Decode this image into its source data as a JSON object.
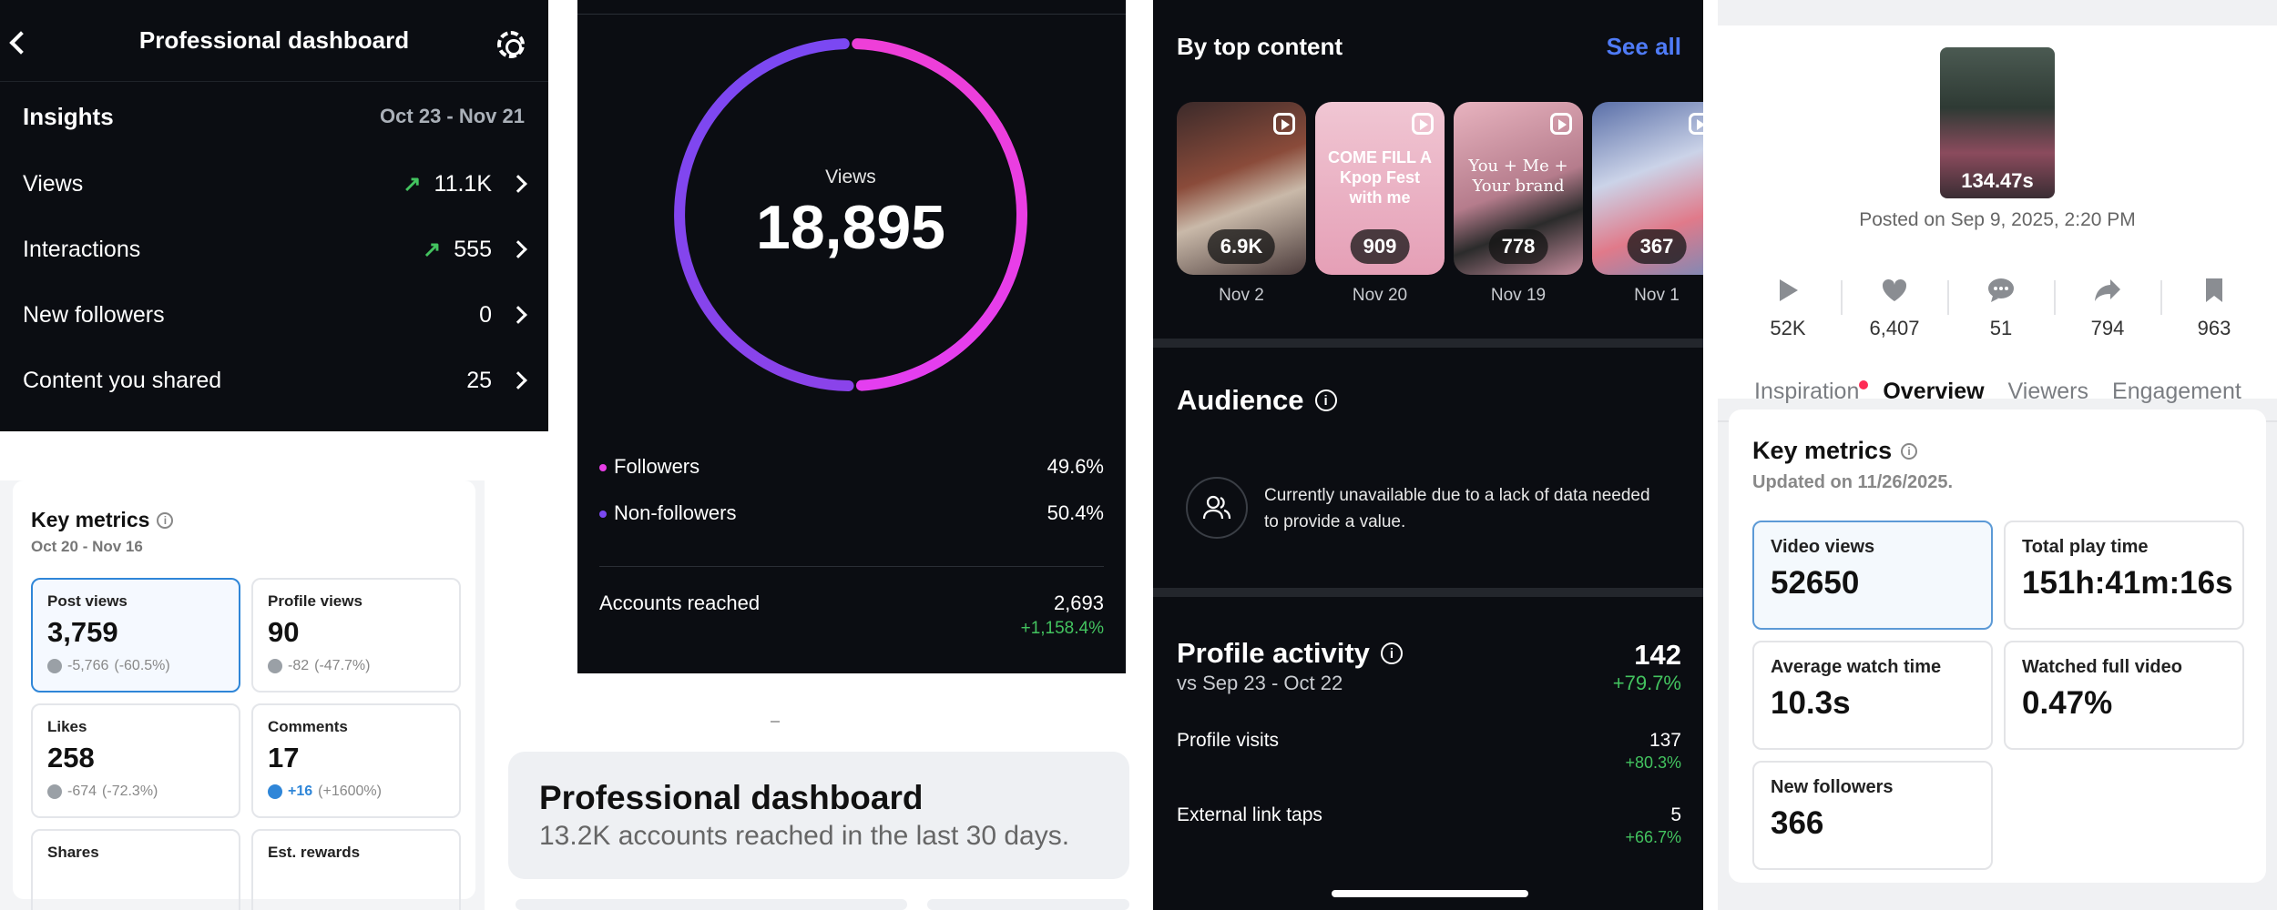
{
  "insights_panel": {
    "title": "Professional dashboard",
    "heading": "Insights",
    "range": "Oct 23 - Nov 21",
    "rows": [
      {
        "label": "Views",
        "value": "11.1K",
        "trend": "up"
      },
      {
        "label": "Interactions",
        "value": "555",
        "trend": "up"
      },
      {
        "label": "New followers",
        "value": "0"
      },
      {
        "label": "Content you shared",
        "value": "25"
      }
    ]
  },
  "key_metrics_panel": {
    "title": "Key metrics",
    "range": "Oct 20 - Nov 16",
    "tiles": [
      {
        "label": "Post views",
        "value": "3,759",
        "change": "-5,766",
        "change_pct": "(-60.5%)"
      },
      {
        "label": "Profile views",
        "value": "90",
        "change": "-82",
        "change_pct": "(-47.7%)"
      },
      {
        "label": "Likes",
        "value": "258",
        "change": "-674",
        "change_pct": "(-72.3%)"
      },
      {
        "label": "Comments",
        "value": "17",
        "change": "+16",
        "change_pct": "(+1600%)"
      },
      {
        "label": "Shares",
        "value": ""
      },
      {
        "label": "Est. rewards",
        "value": ""
      }
    ]
  },
  "views_panel": {
    "donut_label": "Views",
    "total": "18,895",
    "breakdown": [
      {
        "label": "Followers",
        "value": "49.6%",
        "fraction": 0.496,
        "color": "#e83ee6"
      },
      {
        "label": "Non-followers",
        "value": "50.4%",
        "fraction": 0.504,
        "color": "#7b48f2"
      }
    ],
    "accounts_reached_label": "Accounts reached",
    "accounts_reached": "2,693",
    "accounts_reached_change": "+1,158.4%"
  },
  "summary_card": {
    "title": "Professional dashboard",
    "subtitle": "13.2K accounts reached in the last 30 days."
  },
  "top_content_panel": {
    "heading": "By top content",
    "see_all": "See all",
    "items": [
      {
        "views": "6.9K",
        "date": "Nov 2",
        "bg": "#6b3a2a"
      },
      {
        "views": "909",
        "date": "Nov 20",
        "bg": "#e8a9c0",
        "overlay": "COME FILL A Kpop Fest with me"
      },
      {
        "views": "778",
        "date": "Nov 19",
        "bg": "#c98fa0",
        "overlay": "You + Me + Your brand"
      },
      {
        "views": "367",
        "date": "Nov 1",
        "bg": "#8fa0c8"
      }
    ],
    "audience": {
      "heading": "Audience",
      "message": "Currently unavailable due to a lack of data needed to provide a value."
    },
    "profile_activity": {
      "heading": "Profile activity",
      "compare": "vs Sep 23 - Oct 22",
      "total": "142",
      "total_change": "+79.7%",
      "rows": [
        {
          "label": "Profile visits",
          "value": "137",
          "change": "+80.3%"
        },
        {
          "label": "External link taps",
          "value": "5",
          "change": "+66.7%"
        }
      ]
    }
  },
  "video_panel": {
    "cover_caption": "134.47s",
    "posted": "Posted on Sep 9, 2025, 2:20 PM",
    "stats": [
      {
        "icon": "play-icon",
        "value": "52K"
      },
      {
        "icon": "heart-icon",
        "value": "6,407"
      },
      {
        "icon": "comment-icon",
        "value": "51"
      },
      {
        "icon": "share-icon",
        "value": "794"
      },
      {
        "icon": "bookmark-icon",
        "value": "963"
      }
    ],
    "tabs": [
      "Inspiration",
      "Overview",
      "Viewers",
      "Engagement"
    ],
    "active_tab": "Overview",
    "key_metrics_title": "Key metrics",
    "updated": "Updated on 11/26/2025.",
    "tiles": [
      {
        "label": "Video views",
        "value": "52650"
      },
      {
        "label": "Total play time",
        "value": "151h:41m:16s"
      },
      {
        "label": "Average watch time",
        "value": "10.3s"
      },
      {
        "label": "Watched full video",
        "value": "0.47%"
      },
      {
        "label": "New followers",
        "value": "366"
      }
    ]
  }
}
